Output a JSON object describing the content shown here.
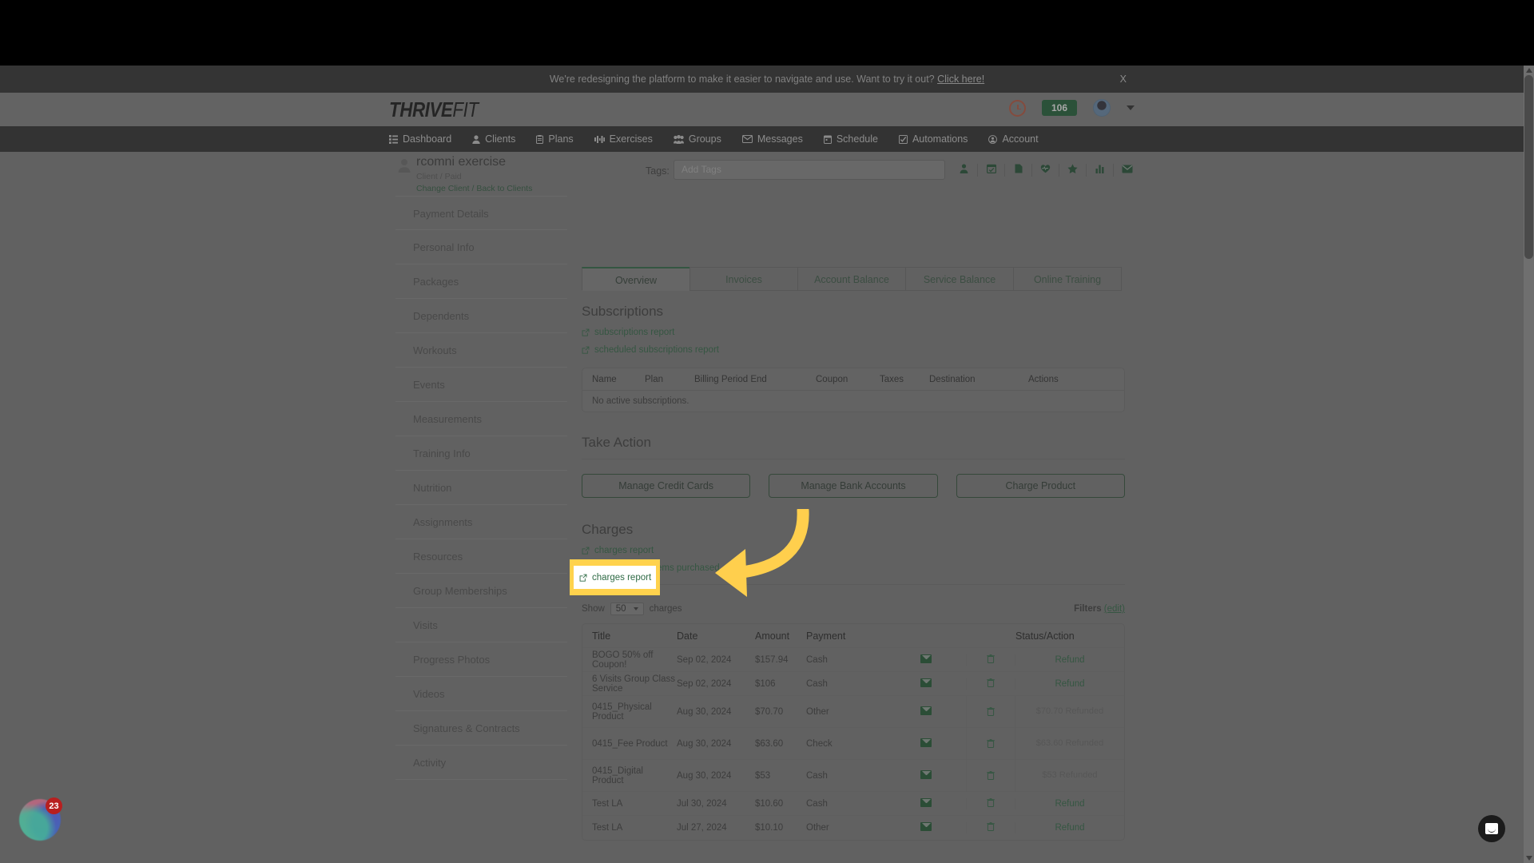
{
  "announcement": {
    "text": "We're redesigning the platform to make it easier to navigate and use. Want to try it out?",
    "link_label": "Click here!",
    "close_label": "X"
  },
  "brand": {
    "name_bold": "THRIVE",
    "name_light": "FIT"
  },
  "header_right": {
    "clock_icon": "clock-icon",
    "count_badge": "106",
    "avatar_icon": "avatar",
    "chevron_icon": "chevron-down-icon"
  },
  "nav": {
    "items": [
      {
        "label": "Dashboard",
        "icon": "dashboard-icon"
      },
      {
        "label": "Clients",
        "icon": "user-icon"
      },
      {
        "label": "Plans",
        "icon": "clipboard-icon"
      },
      {
        "label": "Exercises",
        "icon": "exercise-icon"
      },
      {
        "label": "Groups",
        "icon": "groups-icon"
      },
      {
        "label": "Messages",
        "icon": "envelope-icon"
      },
      {
        "label": "Schedule",
        "icon": "calendar-icon"
      },
      {
        "label": "Automations",
        "icon": "check-square-icon"
      },
      {
        "label": "Account",
        "icon": "account-circle-icon"
      }
    ]
  },
  "client": {
    "name": "rcomni exercise",
    "subtitle": "Client / Paid",
    "change_client": "Change Client",
    "separator": "/",
    "back_to_clients": "Back to Clients",
    "tags_label": "Tags:",
    "tags_placeholder": "Add Tags",
    "action_icons": [
      "person-icon",
      "calendar-check-icon",
      "document-icon",
      "heart-pulse-icon",
      "star-icon",
      "bar-chart-icon",
      "envelope-icon"
    ]
  },
  "sidebar": {
    "items": [
      {
        "label": "Payment Details"
      },
      {
        "label": "Personal Info"
      },
      {
        "label": "Packages"
      },
      {
        "label": "Dependents"
      },
      {
        "label": "Workouts"
      },
      {
        "label": "Events"
      },
      {
        "label": "Measurements"
      },
      {
        "label": "Training Info"
      },
      {
        "label": "Nutrition"
      },
      {
        "label": "Assignments"
      },
      {
        "label": "Resources"
      },
      {
        "label": "Group Memberships"
      },
      {
        "label": "Visits"
      },
      {
        "label": "Progress Photos"
      },
      {
        "label": "Videos"
      },
      {
        "label": "Signatures & Contracts"
      },
      {
        "label": "Activity"
      }
    ]
  },
  "tabs": [
    {
      "label": "Overview",
      "active": true
    },
    {
      "label": "Invoices",
      "active": false
    },
    {
      "label": "Account Balance",
      "active": false
    },
    {
      "label": "Service Balance",
      "active": false
    },
    {
      "label": "Online Training",
      "active": false
    }
  ],
  "subscriptions": {
    "title": "Subscriptions",
    "links": [
      {
        "label": "subscriptions report",
        "icon": "external-link-icon"
      },
      {
        "label": "scheduled subscriptions report",
        "icon": "external-link-icon"
      }
    ],
    "columns": [
      "Name",
      "Plan",
      "Billing Period End",
      "Coupon",
      "Taxes",
      "Destination",
      "Actions"
    ],
    "empty_message": "No active subscriptions."
  },
  "take_action": {
    "title": "Take Action",
    "buttons": [
      "Manage Credit Cards",
      "Manage Bank Accounts",
      "Charge Product"
    ]
  },
  "charges": {
    "title": "Charges",
    "links": [
      {
        "label": "charges report",
        "icon": "external-link-icon",
        "highlighted": true
      },
      {
        "label": "breakdown of items purchased",
        "icon": "external-link-icon",
        "highlighted": false
      }
    ],
    "show_label": "Show",
    "show_value": "50",
    "show_suffix": "charges",
    "filters_label": "Filters",
    "filters_edit": "(edit)",
    "columns": [
      "Title",
      "Date",
      "Amount",
      "Payment",
      "",
      "",
      "Status/Action"
    ],
    "rows": [
      {
        "title": "BOGO 50% off Coupon!",
        "date": "Sep 02, 2024",
        "amount": "$157.94",
        "payment": "Cash",
        "mail": "envelope-icon",
        "delete": "trash-icon",
        "action": "Refund",
        "refunded": false
      },
      {
        "title": "6 Visits Group Class Service",
        "date": "Sep 02, 2024",
        "amount": "$106",
        "payment": "Cash",
        "mail": "envelope-icon",
        "delete": "trash-icon",
        "action": "Refund",
        "refunded": false
      },
      {
        "title": "0415_Physical Product",
        "date": "Aug 30, 2024",
        "amount": "$70.70",
        "payment": "Other",
        "mail": "envelope-icon",
        "delete": "trash-icon",
        "action": "$70.70 Refunded",
        "refunded": true
      },
      {
        "title": "0415_Fee Product",
        "date": "Aug 30, 2024",
        "amount": "$63.60",
        "payment": "Check",
        "mail": "envelope-icon",
        "delete": "trash-icon",
        "action": "$63.60 Refunded",
        "refunded": true
      },
      {
        "title": "0415_Digital Product",
        "date": "Aug 30, 2024",
        "amount": "$53",
        "payment": "Cash",
        "mail": "envelope-icon",
        "delete": "trash-icon",
        "action": "$53 Refunded",
        "refunded": true
      },
      {
        "title": "Test LA",
        "date": "Jul 30, 2024",
        "amount": "$10.60",
        "payment": "Cash",
        "mail": "envelope-icon",
        "delete": "trash-icon",
        "action": "Refund",
        "refunded": false
      },
      {
        "title": "Test LA",
        "date": "Jul 27, 2024",
        "amount": "$10.10",
        "payment": "Other",
        "mail": "envelope-icon",
        "delete": "trash-icon",
        "action": "Refund",
        "refunded": false
      }
    ]
  },
  "widgets": {
    "left_badge_count": "23",
    "left_widget_icon": "color-orb-icon",
    "chat_icon": "chat-bubble-icon"
  },
  "colors": {
    "brand_green": "#2f6b46",
    "highlight_yellow": "#ffd24d",
    "badge_green": "#1d6236",
    "badge_red": "#b81f1f",
    "nav_dark": "#2b2b2b"
  }
}
